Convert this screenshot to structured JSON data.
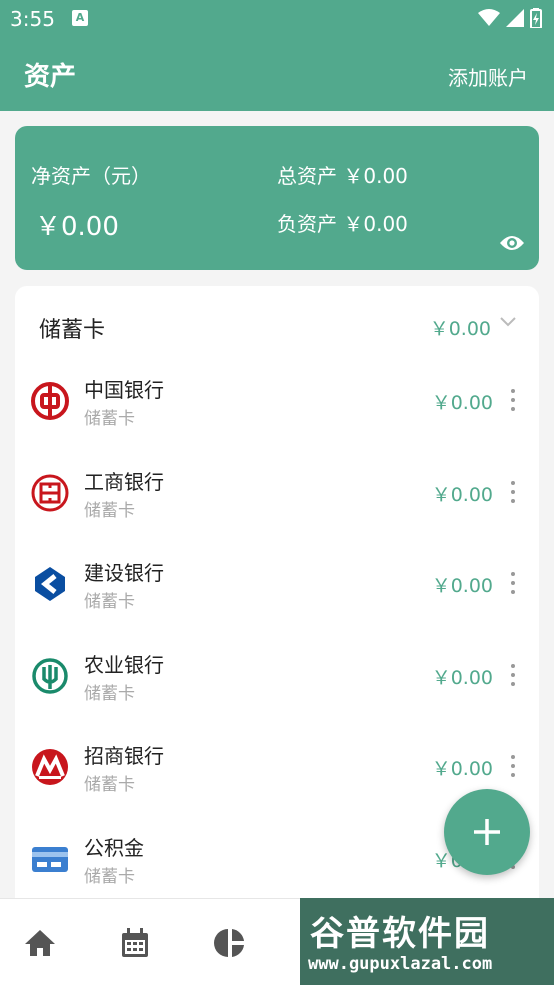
{
  "status_bar": {
    "time": "3:55",
    "notif_letter": "A"
  },
  "app_bar": {
    "title": "资产",
    "action": "添加账户"
  },
  "summary": {
    "net_label": "净资产（元）",
    "net_value": "￥0.00",
    "total_label": "总资产 ￥0.00",
    "debt_label": "负资产 ￥0.00"
  },
  "section": {
    "label": "储蓄卡",
    "amount": "￥0.00"
  },
  "accounts": [
    {
      "name": "中国银行",
      "type": "储蓄卡",
      "amount": "￥0.00",
      "icon": "boc-icon",
      "color": "#c8161d"
    },
    {
      "name": "工商银行",
      "type": "储蓄卡",
      "amount": "￥0.00",
      "icon": "icbc-icon",
      "color": "#c8161d"
    },
    {
      "name": "建设银行",
      "type": "储蓄卡",
      "amount": "￥0.00",
      "icon": "ccb-icon",
      "color": "#0a4ea1"
    },
    {
      "name": "农业银行",
      "type": "储蓄卡",
      "amount": "￥0.00",
      "icon": "abc-icon",
      "color": "#1a8a6b"
    },
    {
      "name": "招商银行",
      "type": "储蓄卡",
      "amount": "￥0.00",
      "icon": "cmb-icon",
      "color": "#c8161d"
    },
    {
      "name": "公积金",
      "type": "储蓄卡",
      "amount": "￥0.00",
      "icon": "card-icon",
      "color": "#3b7fd0"
    }
  ],
  "watermark": {
    "text": "谷普软件园",
    "url": "www.gupuxlazal.com"
  },
  "colors": {
    "accent": "#52a98d",
    "nav_icon": "#555555"
  }
}
